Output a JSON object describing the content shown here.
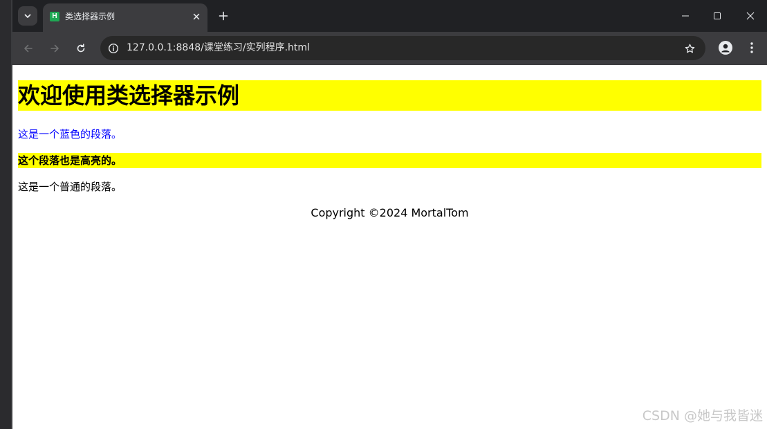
{
  "tab": {
    "favicon_letter": "H",
    "title": "类选择器示例"
  },
  "omnibox": {
    "url": "127.0.0.1:8848/课堂练习/实列程序.html"
  },
  "page": {
    "heading": "欢迎使用类选择器示例",
    "paragraph_blue": "这是一个蓝色的段落。",
    "paragraph_highlight": "这个段落也是高亮的。",
    "paragraph_normal": "这是一个普通的段落。",
    "footer": "Copyright ©2024 MortalTom"
  },
  "watermark": "CSDN @她与我皆迷",
  "colors": {
    "highlight": "#ffff00",
    "blue_text": "#0000ff",
    "favicon": "#1fa854",
    "tab_active": "#3c3c3f",
    "titlebar": "#202124"
  },
  "icons": {
    "tab_list": "chevron-down-icon",
    "tab_close": "close-icon",
    "new_tab": "plus-icon",
    "minimize": "minimize-icon",
    "maximize": "maximize-icon",
    "close_window": "close-icon",
    "back": "arrow-left-icon",
    "forward": "arrow-right-icon",
    "reload": "reload-icon",
    "site_info": "info-icon",
    "bookmark": "star-icon",
    "profile": "person-icon",
    "menu": "kebab-menu-icon"
  }
}
